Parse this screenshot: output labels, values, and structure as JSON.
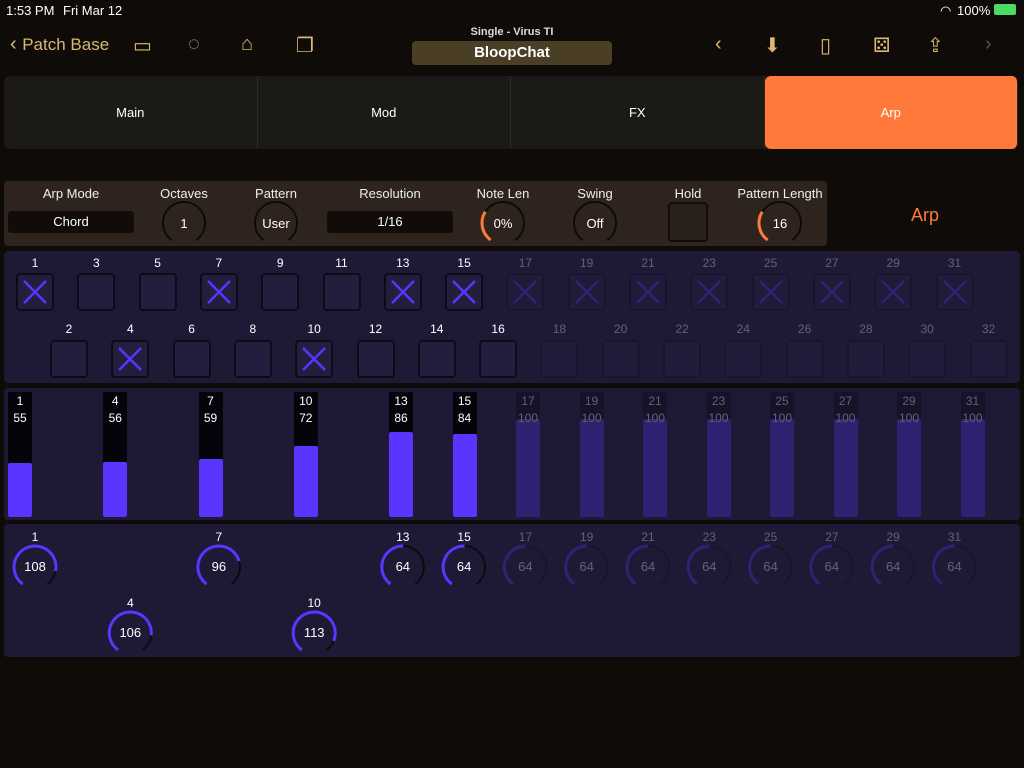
{
  "status_bar": {
    "time": "1:53 PM",
    "date": "Fri Mar 12",
    "battery": "100%"
  },
  "nav": {
    "back_label": "Patch Base",
    "subtitle": "Single - Virus TI",
    "patch_name": "BloopChat"
  },
  "tabs": [
    {
      "label": "Main",
      "active": false
    },
    {
      "label": "Mod",
      "active": false
    },
    {
      "label": "FX",
      "active": false
    },
    {
      "label": "Arp",
      "active": true
    }
  ],
  "params": {
    "arp_mode": {
      "label": "Arp Mode",
      "value": "Chord"
    },
    "octaves": {
      "label": "Octaves",
      "value": "1"
    },
    "pattern": {
      "label": "Pattern",
      "value": "User"
    },
    "resolution": {
      "label": "Resolution",
      "value": "1/16"
    },
    "note_len": {
      "label": "Note Len",
      "value": "0%"
    },
    "swing": {
      "label": "Swing",
      "value": "Off"
    },
    "hold": {
      "label": "Hold",
      "checked": false
    },
    "pattern_length": {
      "label": "Pattern Length",
      "value": "16"
    }
  },
  "section_label": "Arp",
  "colors": {
    "accent": "#ff7a3a",
    "step": "#5a34ff",
    "panel": "#1e1a36"
  },
  "active_steps": 16,
  "steps_on": [
    1,
    4,
    7,
    10,
    13,
    15,
    17,
    19,
    21,
    23,
    25,
    27,
    29,
    31
  ],
  "velocities": [
    {
      "step": 1,
      "value": 55
    },
    {
      "step": 4,
      "value": 56
    },
    {
      "step": 7,
      "value": 59
    },
    {
      "step": 10,
      "value": 72
    },
    {
      "step": 13,
      "value": 86
    },
    {
      "step": 15,
      "value": 84
    },
    {
      "step": 17,
      "value": 100
    },
    {
      "step": 19,
      "value": 100
    },
    {
      "step": 21,
      "value": 100
    },
    {
      "step": 23,
      "value": 100
    },
    {
      "step": 25,
      "value": 100
    },
    {
      "step": 27,
      "value": 100
    },
    {
      "step": 29,
      "value": 100
    },
    {
      "step": 31,
      "value": 100
    }
  ],
  "lengths": [
    {
      "step": 1,
      "value": 108
    },
    {
      "step": 4,
      "value": 106
    },
    {
      "step": 7,
      "value": 96
    },
    {
      "step": 10,
      "value": 113
    },
    {
      "step": 13,
      "value": 64
    },
    {
      "step": 15,
      "value": 64
    },
    {
      "step": 17,
      "value": 64
    },
    {
      "step": 19,
      "value": 64
    },
    {
      "step": 21,
      "value": 64
    },
    {
      "step": 23,
      "value": 64
    },
    {
      "step": 25,
      "value": 64
    },
    {
      "step": 27,
      "value": 64
    },
    {
      "step": 29,
      "value": 64
    },
    {
      "step": 31,
      "value": 64
    }
  ]
}
